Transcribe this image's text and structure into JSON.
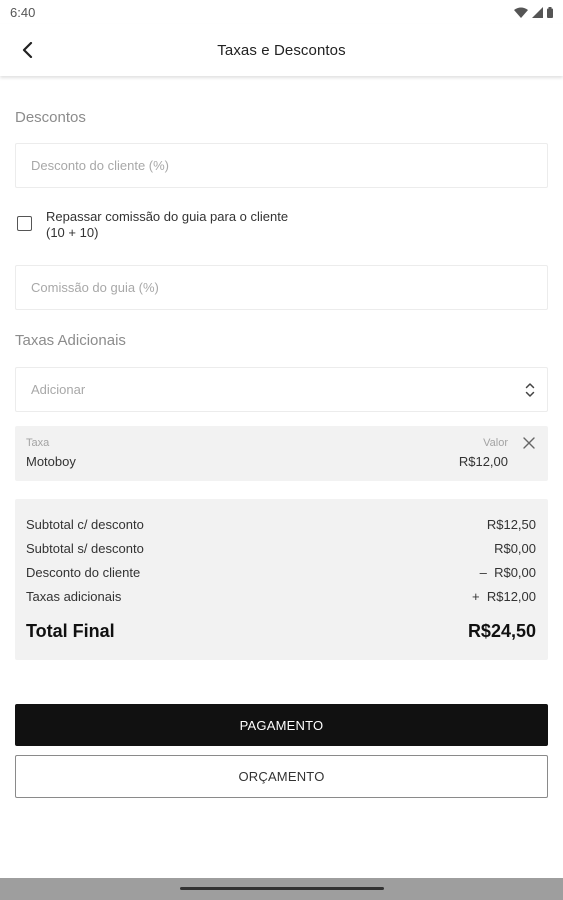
{
  "status_bar": {
    "time": "6:40"
  },
  "app_bar": {
    "title": "Taxas e Descontos"
  },
  "discounts": {
    "section_label": "Descontos",
    "client_discount_placeholder": "Desconto do cliente (%)",
    "pass_commission_label_line1": "Repassar comissão do guia para o cliente",
    "pass_commission_label_line2": "(10 + 10)",
    "pass_commission_checked": false,
    "guide_commission_placeholder": "Comissão do guia (%)"
  },
  "fees": {
    "section_label": "Taxas Adicionais",
    "add_placeholder": "Adicionar",
    "items": [
      {
        "name_header": "Taxa",
        "name": "Motoboy",
        "value_header": "Valor",
        "value": "R$12,00"
      }
    ]
  },
  "summary": {
    "rows": [
      {
        "label": "Subtotal c/ desconto",
        "value": "R$12,50"
      },
      {
        "label": "Subtotal s/ desconto",
        "value": "R$0,00"
      },
      {
        "label": "Desconto do cliente",
        "value": "–  R$0,00"
      },
      {
        "label": "Taxas adicionais",
        "value": "+  R$12,00"
      }
    ],
    "total_label": "Total Final",
    "total_value": "R$24,50"
  },
  "actions": {
    "payment_label": "PAGAMENTO",
    "quote_label": "ORÇAMENTO"
  },
  "icons": {
    "back": "arrow-back-icon",
    "wifi": "wifi-icon",
    "signal": "signal-icon",
    "battery": "battery-icon",
    "select": "unfold-icon",
    "remove": "close-icon"
  },
  "colors": {
    "primary_button": "#111111",
    "card_background": "#f2f2f2",
    "muted_text": "#8c8c8c"
  }
}
